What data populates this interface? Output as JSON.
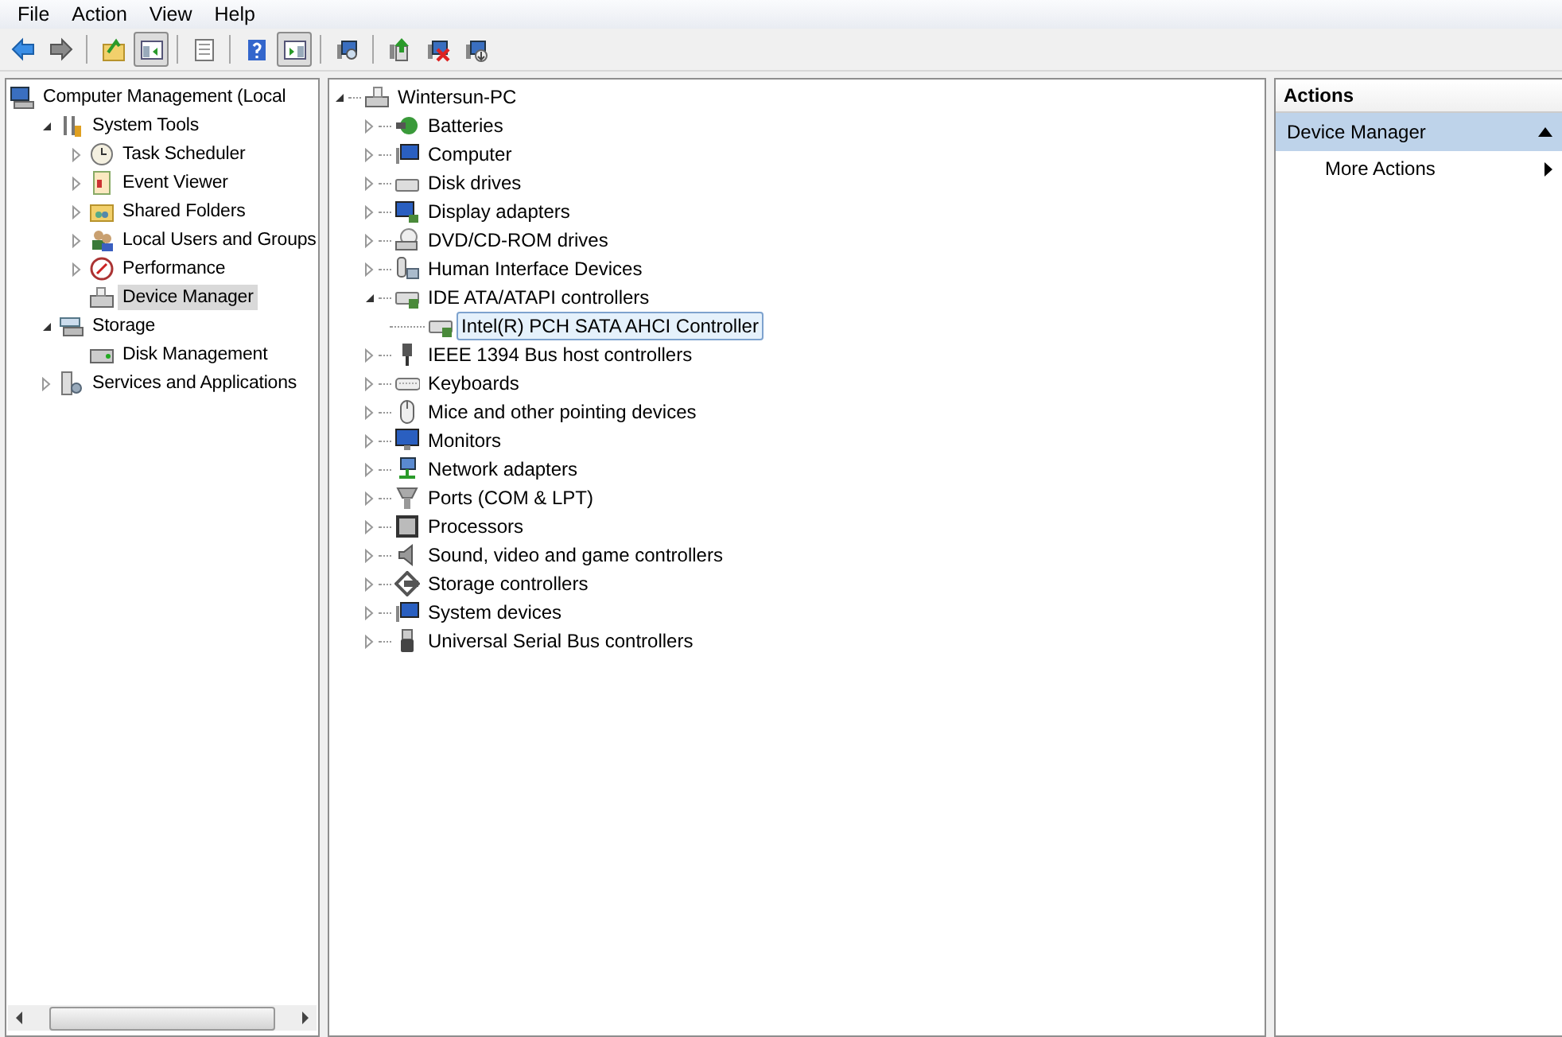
{
  "menu": [
    "File",
    "Action",
    "View",
    "Help"
  ],
  "toolbar": [
    {
      "kind": "button",
      "on": false
    },
    {
      "kind": "button",
      "on": false
    },
    {
      "kind": "separator"
    },
    {
      "kind": "button",
      "on": false
    },
    {
      "kind": "button",
      "on": true
    },
    {
      "kind": "separator"
    },
    {
      "kind": "button",
      "on": false
    },
    {
      "kind": "separator"
    },
    {
      "kind": "button",
      "on": false
    },
    {
      "kind": "button",
      "on": true
    },
    {
      "kind": "separator"
    },
    {
      "kind": "button",
      "on": false
    },
    {
      "kind": "separator"
    },
    {
      "kind": "button",
      "on": false
    },
    {
      "kind": "button",
      "on": false
    },
    {
      "kind": "button",
      "on": false
    }
  ],
  "console_tree": [
    {
      "label": "Computer Management (Local",
      "selected": false,
      "children": [
        {
          "label": "System Tools",
          "kind": "branch",
          "expanded": true,
          "selected": false,
          "children": [
            {
              "label": "Task Scheduler",
              "kind": "branch",
              "expanded": false,
              "selected": false
            },
            {
              "label": "Event Viewer",
              "kind": "branch",
              "expanded": false,
              "selected": false
            },
            {
              "label": "Shared Folders",
              "kind": "branch",
              "expanded": false,
              "selected": false
            },
            {
              "label": "Local Users and Groups",
              "kind": "branch",
              "expanded": false,
              "selected": false
            },
            {
              "label": "Performance",
              "kind": "branch",
              "expanded": false,
              "selected": false
            },
            {
              "label": "Device Manager",
              "kind": "leaf",
              "selected": true
            }
          ]
        },
        {
          "label": "Storage",
          "kind": "branch",
          "expanded": true,
          "selected": false,
          "children": [
            {
              "label": "Disk Management",
              "kind": "leaf",
              "selected": false
            }
          ]
        },
        {
          "label": "Services and Applications",
          "kind": "branch",
          "expanded": false,
          "selected": false
        }
      ]
    }
  ],
  "device_tree": [
    {
      "label": "Wintersun-PC",
      "kind": "branch",
      "expanded": true,
      "selected": false,
      "children": [
        {
          "label": "Batteries",
          "kind": "branch",
          "expanded": false,
          "selected": false
        },
        {
          "label": "Computer",
          "kind": "branch",
          "expanded": false,
          "selected": false
        },
        {
          "label": "Disk drives",
          "kind": "branch",
          "expanded": false,
          "selected": false
        },
        {
          "label": "Display adapters",
          "kind": "branch",
          "expanded": false,
          "selected": false
        },
        {
          "label": "DVD/CD-ROM drives",
          "kind": "branch",
          "expanded": false,
          "selected": false
        },
        {
          "label": "Human Interface Devices",
          "kind": "branch",
          "expanded": false,
          "selected": false
        },
        {
          "label": "IDE ATA/ATAPI controllers",
          "kind": "branch",
          "expanded": true,
          "selected": false,
          "children": [
            {
              "label": "Intel(R) PCH SATA AHCI Controller",
              "kind": "leaf",
              "selected": true
            }
          ]
        },
        {
          "label": "IEEE 1394 Bus host controllers",
          "kind": "branch",
          "expanded": false,
          "selected": false
        },
        {
          "label": "Keyboards",
          "kind": "branch",
          "expanded": false,
          "selected": false
        },
        {
          "label": "Mice and other pointing devices",
          "kind": "branch",
          "expanded": false,
          "selected": false
        },
        {
          "label": "Monitors",
          "kind": "branch",
          "expanded": false,
          "selected": false
        },
        {
          "label": "Network adapters",
          "kind": "branch",
          "expanded": false,
          "selected": false
        },
        {
          "label": "Ports (COM & LPT)",
          "kind": "branch",
          "expanded": false,
          "selected": false
        },
        {
          "label": "Processors",
          "kind": "branch",
          "expanded": false,
          "selected": false
        },
        {
          "label": "Sound, video and game controllers",
          "kind": "branch",
          "expanded": false,
          "selected": false
        },
        {
          "label": "Storage controllers",
          "kind": "branch",
          "expanded": false,
          "selected": false
        },
        {
          "label": "System devices",
          "kind": "branch",
          "expanded": false,
          "selected": false
        },
        {
          "label": "Universal Serial Bus controllers",
          "kind": "branch",
          "expanded": false,
          "selected": false
        }
      ]
    }
  ],
  "actions": {
    "title": "Actions",
    "section": {
      "label": "Device Manager",
      "expanded": true
    },
    "items": [
      {
        "label": "More Actions"
      }
    ]
  }
}
